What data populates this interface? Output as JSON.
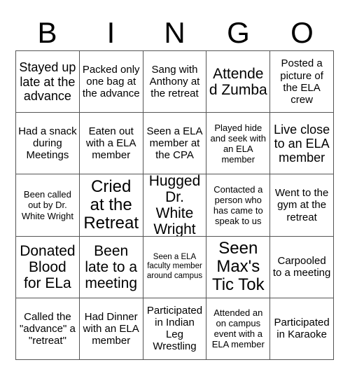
{
  "card": {
    "title": "BINGO",
    "header_letters": [
      "B",
      "I",
      "N",
      "G",
      "O"
    ],
    "rows": [
      [
        {
          "text": "Stayed up late at the advance",
          "size": "lg"
        },
        {
          "text": "Packed only one bag at the advance",
          "size": "md"
        },
        {
          "text": "Sang with Anthony at the retreat",
          "size": "md"
        },
        {
          "text": "Attended Zumba",
          "size": "xl"
        },
        {
          "text": "Posted a picture of the ELA crew",
          "size": "md"
        }
      ],
      [
        {
          "text": "Had a snack during Meetings",
          "size": "md"
        },
        {
          "text": "Eaten out with a ELA member",
          "size": "md"
        },
        {
          "text": "Seen a ELA member at the CPA",
          "size": "md"
        },
        {
          "text": "Played hide and seek with an ELA member",
          "size": "sm"
        },
        {
          "text": "Live close to an ELA member",
          "size": "lg"
        }
      ],
      [
        {
          "text": "Been called out by Dr. White Wright",
          "size": "sm"
        },
        {
          "text": "Cried at the Retreat",
          "size": "xxl"
        },
        {
          "text": "Hugged Dr. White Wright",
          "size": "xl"
        },
        {
          "text": "Contacted a person who has came to speak to us",
          "size": "sm"
        },
        {
          "text": "Went to the gym at the retreat",
          "size": "md"
        }
      ],
      [
        {
          "text": "Donated Blood for ELa",
          "size": "xl"
        },
        {
          "text": "Been late to a meeting",
          "size": "xl"
        },
        {
          "text": "Seen a ELA faculty member around campus",
          "size": "xs"
        },
        {
          "text": "Seen Max's Tic Tok",
          "size": "xxl"
        },
        {
          "text": "Carpooled to a meeting",
          "size": "md"
        }
      ],
      [
        {
          "text": "Called the \"advance\" a \"retreat\"",
          "size": "md"
        },
        {
          "text": "Had Dinner with an ELA member",
          "size": "md"
        },
        {
          "text": "Participated in Indian Leg Wrestling",
          "size": "md"
        },
        {
          "text": "Attended an on campus event with a ELA member",
          "size": "sm"
        },
        {
          "text": "Participated in Karaoke",
          "size": "md"
        }
      ]
    ],
    "colors": {
      "background": "#ffffff",
      "text": "#000000",
      "border": "#555555"
    }
  }
}
